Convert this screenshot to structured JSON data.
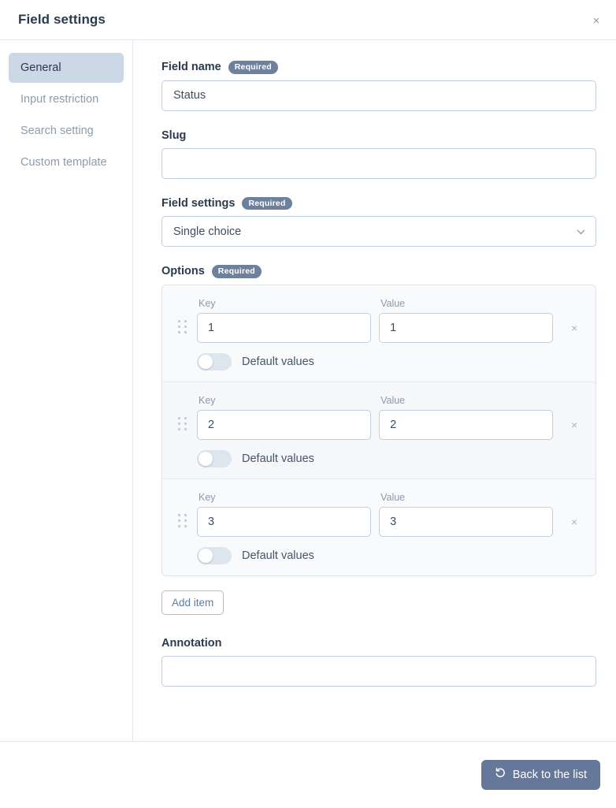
{
  "header": {
    "title": "Field settings",
    "close_label": "×"
  },
  "sidebar": {
    "items": [
      {
        "label": "General",
        "active": true
      },
      {
        "label": "Input restriction",
        "active": false
      },
      {
        "label": "Search setting",
        "active": false
      },
      {
        "label": "Custom template",
        "active": false
      }
    ]
  },
  "form": {
    "field_name": {
      "label": "Field name",
      "badge": "Required",
      "value": "Status",
      "placeholder": ""
    },
    "slug": {
      "label": "Slug",
      "value": "",
      "placeholder": ""
    },
    "field_settings": {
      "label": "Field settings",
      "badge": "Required",
      "value": "Single choice",
      "options": [
        "Single choice"
      ]
    },
    "options": {
      "label": "Options",
      "badge": "Required",
      "key_label": "Key",
      "value_label": "Value",
      "default_label": "Default values",
      "remove_label": "×",
      "items": [
        {
          "key": "1",
          "value": "1",
          "default_on": false
        },
        {
          "key": "2",
          "value": "2",
          "default_on": false
        },
        {
          "key": "3",
          "value": "3",
          "default_on": false
        }
      ],
      "add_label": "Add item"
    },
    "annotation": {
      "label": "Annotation",
      "value": "",
      "placeholder": ""
    }
  },
  "footer": {
    "back_label": "Back to the list"
  },
  "colors": {
    "accent": "#65789a",
    "badge": "#6d809c",
    "active_nav": "#ccd8e6",
    "border": "#c3cfdd",
    "link": "#5b7ca8"
  }
}
